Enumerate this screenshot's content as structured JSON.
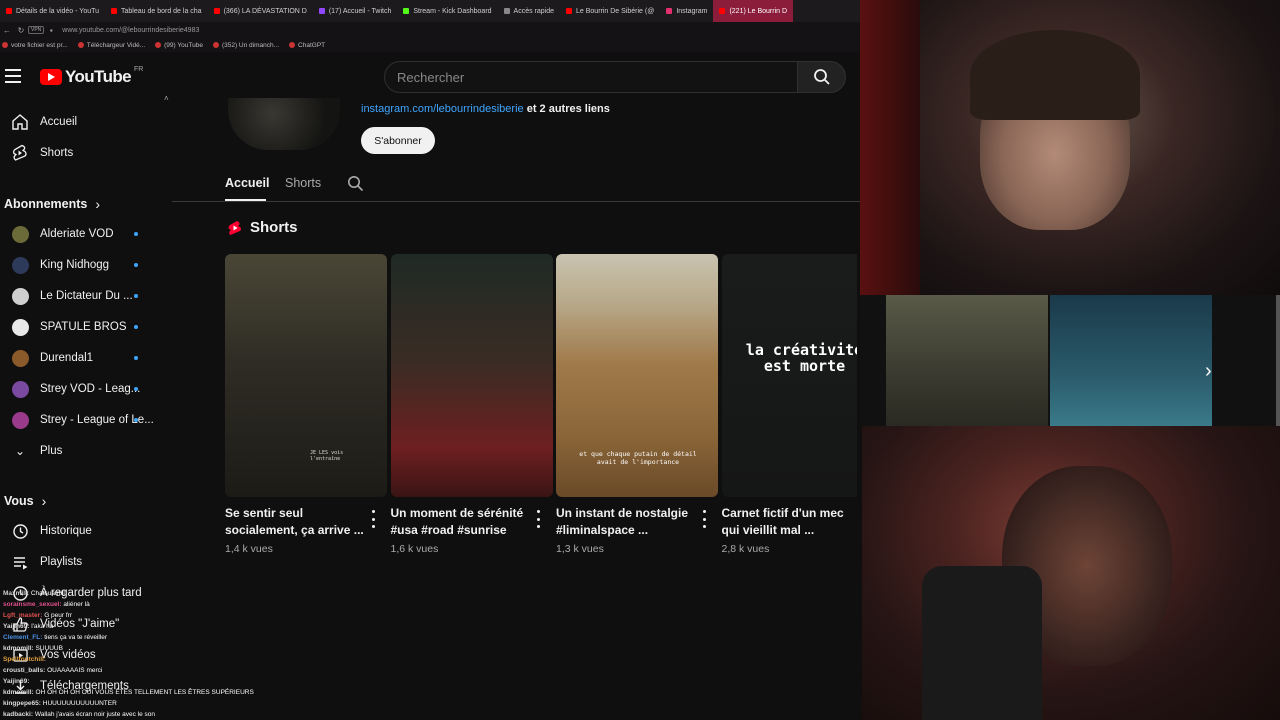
{
  "browser": {
    "tabs": [
      {
        "label": "Détails de la vidéo - YouTu",
        "color": "#ff0000",
        "active": false
      },
      {
        "label": "Tableau de bord de la cha",
        "color": "#ff0000",
        "active": false
      },
      {
        "label": "(366) LA DÉVASTATION D",
        "color": "#ff0000",
        "active": false
      },
      {
        "label": "(17) Accueil - Twitch",
        "color": "#9146ff",
        "active": false
      },
      {
        "label": "Stream - Kick Dashboard",
        "color": "#53fc18",
        "active": false
      },
      {
        "label": "Accès rapide",
        "color": "#888888",
        "active": false
      },
      {
        "label": "Le Bourrin De Sibérie (@",
        "color": "#ff0000",
        "active": false
      },
      {
        "label": "Instagram",
        "color": "#e1306c",
        "active": false
      },
      {
        "label": "(221) Le Bourrin D",
        "color": "#ff0000",
        "active": true
      }
    ],
    "url": "www.youtube.com/@lebourrindesiberie4983",
    "bookmarks": [
      "votre fichier est pr...",
      "Téléchargeur Vidé...",
      "(99) YouTube",
      "(352) Un dimanch...",
      "ChatGPT"
    ]
  },
  "masthead": {
    "logo": "YouTube",
    "region": "FR",
    "search_placeholder": "Rechercher"
  },
  "sidebar": {
    "main": [
      {
        "label": "Accueil",
        "icon": "home-icon"
      },
      {
        "label": "Shorts",
        "icon": "shorts-icon"
      }
    ],
    "subscriptions_heading": "Abonnements",
    "subscriptions": [
      {
        "label": "Alderiate VOD",
        "color": "#6b6b3a"
      },
      {
        "label": "King Nidhogg",
        "color": "#2d3a5a"
      },
      {
        "label": "Le Dictateur Du ...",
        "color": "#cfcfcf"
      },
      {
        "label": "SPATULE BROS",
        "color": "#e8e8e8"
      },
      {
        "label": "Durendal1",
        "color": "#8a5a2a"
      },
      {
        "label": "Strey VOD - Leag...",
        "color": "#7a4aa0"
      },
      {
        "label": "Strey - League of Le...",
        "color": "#9a3a8a"
      }
    ],
    "more_label": "Plus",
    "you_heading": "Vous",
    "you_items": [
      {
        "label": "Historique",
        "icon": "history-icon"
      },
      {
        "label": "Playlists",
        "icon": "playlists-icon"
      },
      {
        "label": "À regarder plus tard",
        "icon": "watch-later-icon"
      },
      {
        "label": "Vidéos \"J'aime\"",
        "icon": "like-icon"
      },
      {
        "label": "Vos vidéos",
        "icon": "your-videos-icon"
      },
      {
        "label": "Téléchargements",
        "icon": "download-icon"
      }
    ]
  },
  "channel": {
    "link": "instagram.com/lebourrindesiberie",
    "link_suffix": "et 2 autres liens",
    "subscribe_label": "S'abonner",
    "tabs": [
      "Accueil",
      "Shorts"
    ],
    "section_title": "Shorts",
    "shorts": [
      {
        "title": "Se sentir seul socialement, ça arrive ...",
        "views": "1,4 k vues",
        "caption": "JE LES vois l'entraîne",
        "bg": "linear-gradient(180deg,#4a4636 0%,#2e2c24 45%,#1c1b16 100%)"
      },
      {
        "title": "Un moment de sérénité #usa #road #sunrise",
        "views": "1,6 k vues",
        "caption": "",
        "bg": "linear-gradient(180deg,#1f2a25 0%,#3a2c24 45%,#6e1f20 80%,#3a1414 100%)"
      },
      {
        "title": "Un instant de nostalgie #liminalspace ...",
        "views": "1,3 k vues",
        "caption": "et que chaque putain de détail avait de l'importance",
        "bg": "linear-gradient(180deg,#c9c3b0 0%,#b8a98a 20%,#a07a4a 45%,#8a6538 75%,#6a4a28 100%)"
      },
      {
        "title": "Carnet fictif d'un mec qui vieillit mal ...",
        "views": "2,8 k vues",
        "caption": "la créativité est morte",
        "bg": "linear-gradient(180deg,#1a1c1c 0%,#151616 100%)"
      }
    ]
  },
  "chat": [
    {
      "user": "Maxmill:",
      "msg": "Chatsuamill",
      "color": "#cccccc"
    },
    {
      "user": "sorainsme_sexuel:",
      "msg": "aliéner là",
      "color": "#e0508a"
    },
    {
      "user": "Lgft_master:",
      "msg": "G peur frr",
      "color": "#e05050"
    },
    {
      "user": "Yaijin69:",
      "msg": "l'aka ha",
      "color": "#dddddd"
    },
    {
      "user": "Clement_FL:",
      "msg": "tiens ça va te réveiller",
      "color": "#4a90e0"
    },
    {
      "user": "kdmomill:",
      "msg": "SUUUUB",
      "color": "#dddddd"
    },
    {
      "user": "Spellfoutchill:",
      "msg": "",
      "color": "#e0a040"
    },
    {
      "user": "crousti_balls:",
      "msg": "OUAAAAAIS merci",
      "color": "#dddddd"
    },
    {
      "user": "Yaijin69:",
      "msg": "",
      "color": "#dddddd"
    },
    {
      "user": "kdmomill:",
      "msg": "OH OH OH OH OUI VOUS ÊTES TELLEMENT LES ÊTRES SUPÉRIEURS",
      "color": "#dddddd"
    },
    {
      "user": "kingpepe65:",
      "msg": "HUUUUUUUUUUUNTER",
      "color": "#dddddd"
    },
    {
      "user": "kadbacki:",
      "msg": "Wallah j'avais écran noir juste avec le son",
      "color": "#dddddd"
    }
  ],
  "colors": {
    "background": "#0f0f0f",
    "accent_red": "#ff0000",
    "link_blue": "#3ea6ff"
  }
}
